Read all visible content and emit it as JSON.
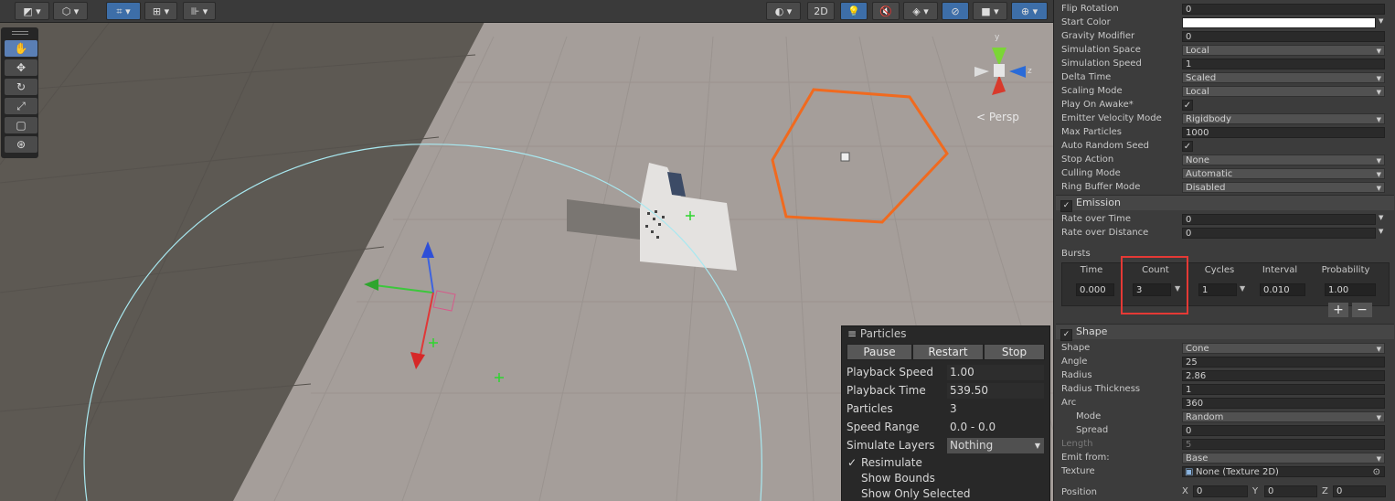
{
  "toolbar": {
    "btn_2d": "2D"
  },
  "scene": {
    "persp_label": "< Persp",
    "gizmo_axis_z": "z",
    "gizmo_axis_y": "y"
  },
  "particles_panel": {
    "title": "Particles",
    "pause": "Pause",
    "restart": "Restart",
    "stop": "Stop",
    "rows": [
      {
        "label": "Playback Speed",
        "value": "1.00"
      },
      {
        "label": "Playback Time",
        "value": "539.50"
      },
      {
        "label": "Particles",
        "value": "3"
      },
      {
        "label": "Speed Range",
        "value": "0.0 - 0.0"
      },
      {
        "label": "Simulate Layers",
        "value": "Nothing"
      }
    ],
    "checks": [
      {
        "label": "Resimulate",
        "checked": "✓"
      },
      {
        "label": "Show Bounds",
        "checked": ""
      },
      {
        "label": "Show Only Selected",
        "checked": ""
      }
    ]
  },
  "inspector": {
    "main": [
      {
        "label": "Flip Rotation",
        "value": "0"
      },
      {
        "label": "Start Color",
        "value": ""
      },
      {
        "label": "Gravity Modifier",
        "value": "0"
      },
      {
        "label": "Simulation Space",
        "value": "Local"
      },
      {
        "label": "Simulation Speed",
        "value": "1"
      },
      {
        "label": "Delta Time",
        "value": "Scaled"
      },
      {
        "label": "Scaling Mode",
        "value": "Local"
      },
      {
        "label": "Play On Awake*",
        "value": "✓"
      },
      {
        "label": "Emitter Velocity Mode",
        "value": "Rigidbody"
      },
      {
        "label": "Max Particles",
        "value": "1000"
      },
      {
        "label": "Auto Random Seed",
        "value": "✓"
      },
      {
        "label": "Stop Action",
        "value": "None"
      },
      {
        "label": "Culling Mode",
        "value": "Automatic"
      },
      {
        "label": "Ring Buffer Mode",
        "value": "Disabled"
      }
    ],
    "emission": {
      "title": "Emission",
      "rows": [
        {
          "label": "Rate over Time",
          "value": "0"
        },
        {
          "label": "Rate over Distance",
          "value": "0"
        }
      ],
      "bursts_label": "Bursts",
      "bursts_headers": [
        "Time",
        "Count",
        "Cycles",
        "Interval",
        "Probability"
      ],
      "bursts_values": [
        "0.000",
        "3",
        "1",
        "0.010",
        "1.00"
      ]
    },
    "shape": {
      "title": "Shape",
      "rows": [
        {
          "label": "Shape",
          "value": "Cone"
        },
        {
          "label": "Angle",
          "value": "25"
        },
        {
          "label": "Radius",
          "value": "2.86"
        },
        {
          "label": "Radius Thickness",
          "value": "1"
        },
        {
          "label": "Arc",
          "value": "360"
        },
        {
          "label": "Mode",
          "value": "Random"
        },
        {
          "label": "Spread",
          "value": "0"
        },
        {
          "label": "Length",
          "value": "5"
        },
        {
          "label": "Emit from:",
          "value": "Base"
        },
        {
          "label": "Texture",
          "value": "None (Texture 2D)"
        }
      ],
      "position_label": "Position",
      "position": {
        "x": "0",
        "y": "0",
        "z": "0"
      },
      "axis_x": "X",
      "axis_y": "Y",
      "axis_z": "Z"
    },
    "add_button": "+",
    "remove_button": "−"
  },
  "colors": {
    "accent": "#3d6ea8",
    "highlight": "#e53935",
    "hexagon": "#f06a1f"
  }
}
